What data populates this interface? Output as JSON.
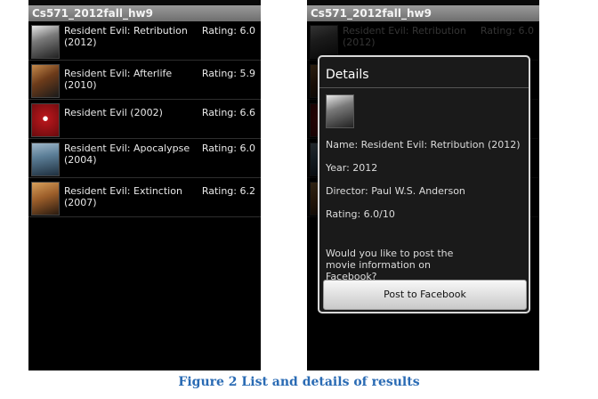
{
  "app_title": "Cs571_2012fall_hw9",
  "movies": [
    {
      "title": "Resident Evil: Retribution (2012)",
      "rating": "Rating: 6.0",
      "poster_icon": "evil-poster-icon"
    },
    {
      "title": "Resident Evil: Afterlife (2010)",
      "rating": "Rating: 5.9",
      "poster_icon": "afterlife-poster-icon"
    },
    {
      "title": "Resident Evil (2002)",
      "rating": "Rating: 6.6",
      "poster_icon": "resident-evil-poster-icon"
    },
    {
      "title": "Resident Evil: Apocalypse (2004)",
      "rating": "Rating: 6.0",
      "poster_icon": "apocalypse-poster-icon"
    },
    {
      "title": "Resident Evil: Extinction (2007)",
      "rating": "Rating: 6.2",
      "poster_icon": "extinction-poster-icon"
    }
  ],
  "dialog": {
    "title": "Details",
    "name": "Name: Resident Evil: Retribution (2012)",
    "year": "Year: 2012",
    "director": "Director: Paul W.S. Anderson",
    "rating": "Rating: 6.0/10",
    "prompt": "Would you like to post the movie information on Facebook?",
    "button": "Post to Facebook"
  },
  "caption": "Figure 2 List and details of results"
}
